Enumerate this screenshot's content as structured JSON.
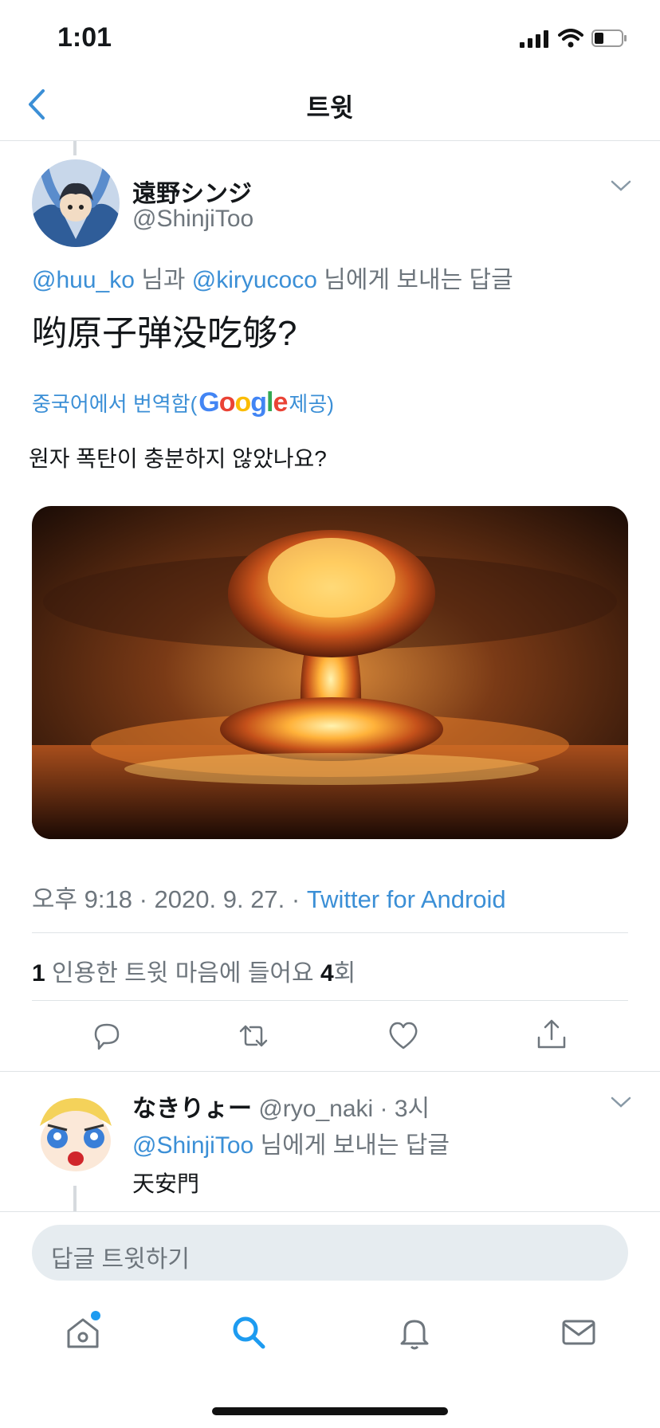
{
  "status_bar": {
    "time": "1:01"
  },
  "header": {
    "title": "트윗"
  },
  "tweet": {
    "author_name": "遠野シンジ",
    "author_handle": "@ShinjiToo",
    "reply_mention_1": "@huu_ko",
    "reply_connector": " 님과 ",
    "reply_mention_2": "@kiryucoco",
    "reply_suffix": " 님에게 보내는 답글",
    "text": "哟原子弹没吃够?",
    "translate_prefix": "중국어에서 번역함(",
    "translate_brand": "Google",
    "translate_suffix": " 제공)",
    "translated_text": "원자 폭탄이 충분하지 않았나요?",
    "timestamp": "오후 9:18 · 2020. 9. 27. · ",
    "source": "Twitter for Android",
    "quote_count": "1",
    "quote_label": " 인용한 트윗  마음에 들어요 ",
    "like_count": "4",
    "like_label": "회"
  },
  "actions": {
    "reply_icon": "reply-icon",
    "retweet_icon": "retweet-icon",
    "like_icon": "heart-icon",
    "share_icon": "share-icon"
  },
  "reply": {
    "author_name": "なきりょー",
    "author_handle": "@ryo_naki",
    "time": " · 3시",
    "mention": "@ShinjiToo",
    "mention_suffix": " 님에게 보내는 답글",
    "text": "天安門"
  },
  "compose": {
    "placeholder": "답글 트윗하기"
  },
  "tabbar": [
    "home-icon",
    "search-icon",
    "bell-icon",
    "mail-icon"
  ],
  "colors": {
    "accent": "#1d9bf0",
    "link": "#3b8fd6"
  }
}
